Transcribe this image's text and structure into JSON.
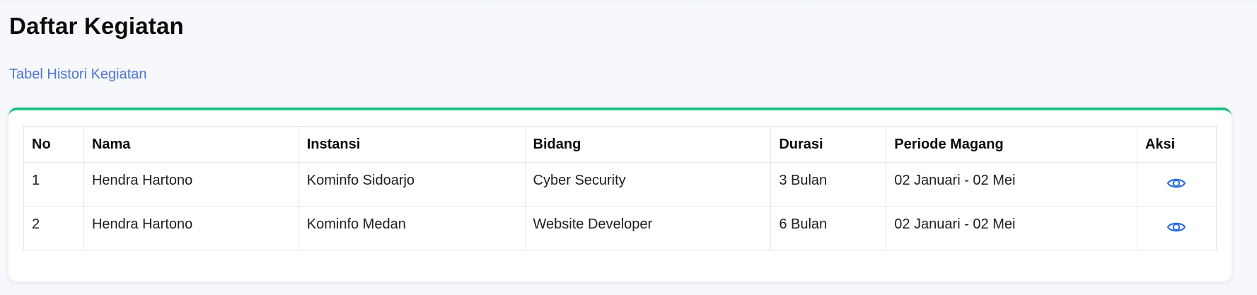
{
  "page": {
    "title": "Daftar Kegiatan",
    "subtitle": "Tabel Histori Kegiatan"
  },
  "table": {
    "headers": {
      "no": "No",
      "nama": "Nama",
      "instansi": "Instansi",
      "bidang": "Bidang",
      "durasi": "Durasi",
      "periode": "Periode Magang",
      "aksi": "Aksi"
    },
    "rows": [
      {
        "no": "1",
        "nama": "Hendra Hartono",
        "instansi": "Kominfo Sidoarjo",
        "bidang": "Cyber Security",
        "durasi": "3 Bulan",
        "periode": "02 Januari - 02 Mei",
        "action_icon": "eye-icon"
      },
      {
        "no": "2",
        "nama": "Hendra Hartono",
        "instansi": "Kominfo Medan",
        "bidang": "Website Developer",
        "durasi": "6 Bulan",
        "periode": "02 Januari - 02 Mei",
        "action_icon": "eye-icon"
      }
    ]
  },
  "colors": {
    "accent": "#1fbf82",
    "subtitle": "#4f74d6",
    "icon": "#2f6fe0",
    "background": "#f6f8fc"
  }
}
